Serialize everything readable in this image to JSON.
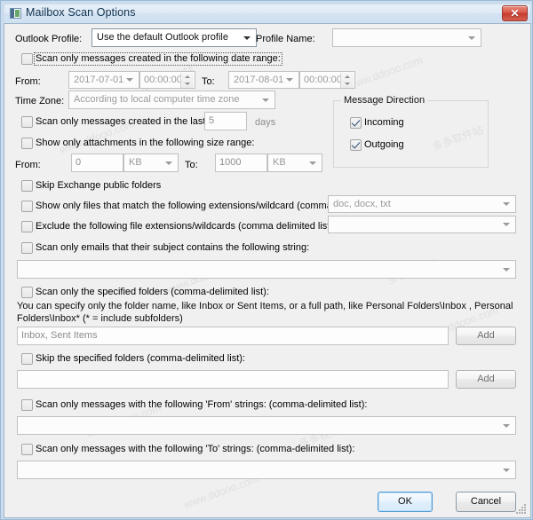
{
  "window": {
    "title": "Mailbox Scan Options",
    "close_label": "✖",
    "icon": "mailbox-icon"
  },
  "profile": {
    "outlook_profile_label": "Outlook Profile:",
    "outlook_profile_value": "Use the default Outlook profile",
    "profile_name_label": "Profile Name:",
    "profile_name_value": ""
  },
  "date_range": {
    "checkbox_label": "Scan only messages created in the following date range:",
    "checked": false,
    "from_label": "From:",
    "from_date": "2017-07-01",
    "from_time": "00:00:00",
    "to_label": "To:",
    "to_date": "2017-08-01",
    "to_time": "00:00:00",
    "time_zone_label": "Time Zone:",
    "time_zone_value": "According to local computer time zone"
  },
  "last_days": {
    "checkbox_label": "Scan only messages created in the last",
    "checked": false,
    "value": "5",
    "unit_label": "days"
  },
  "size_range": {
    "checkbox_label": "Show only attachments in the following size range:",
    "checked": false,
    "from_label": "From:",
    "from_value": "0",
    "from_unit": "KB",
    "to_label": "To:",
    "to_value": "1000",
    "to_unit": "KB"
  },
  "message_direction": {
    "group_title": "Message Direction",
    "incoming_label": "Incoming",
    "incoming_checked": true,
    "outgoing_label": "Outgoing",
    "outgoing_checked": true
  },
  "skip_public_folders": {
    "checkbox_label": "Skip Exchange public folders",
    "checked": false
  },
  "include_extensions": {
    "checkbox_label": "Show only files that match the following extensions/wildcard (comma delimited)",
    "checked": false,
    "value": "doc, docx, txt"
  },
  "exclude_extensions": {
    "checkbox_label": "Exclude the following file extensions/wildcards (comma delimited list):",
    "checked": false,
    "value": ""
  },
  "subject_filter": {
    "checkbox_label": "Scan only emails that their subject contains the following string:",
    "checked": false,
    "value": ""
  },
  "specified_folders": {
    "checkbox_label": "Scan only the specified folders (comma-delimited list):",
    "checked": false,
    "hint_line1": "You can specify only the folder name, like Inbox or Sent Items, or a full path, like Personal Folders\\Inbox , Personal",
    "hint_line2": "Folders\\Inbox*  (* = include subfolders)",
    "placeholder": "Inbox, Sent Items",
    "add_label": "Add"
  },
  "skip_folders": {
    "checkbox_label": "Skip the specified folders (comma-delimited list):",
    "checked": false,
    "value": "",
    "add_label": "Add"
  },
  "from_strings": {
    "checkbox_label": "Scan only messages with the following 'From' strings: (comma-delimited list):",
    "checked": false,
    "value": ""
  },
  "to_strings": {
    "checkbox_label": "Scan only messages with the following 'To' strings: (comma-delimited list):",
    "checked": false,
    "value": ""
  },
  "footer": {
    "ok_label": "OK",
    "cancel_label": "Cancel"
  },
  "watermarks": {
    "a": "www.ddooo.com",
    "b": "多多软件站"
  },
  "colors": {
    "titlebar": "#d3e2f2",
    "frame": "#cbdcec",
    "client_bg": "#f0f0f0",
    "close_red": "#c73a2c",
    "default_button_border": "#4f9ad6"
  }
}
